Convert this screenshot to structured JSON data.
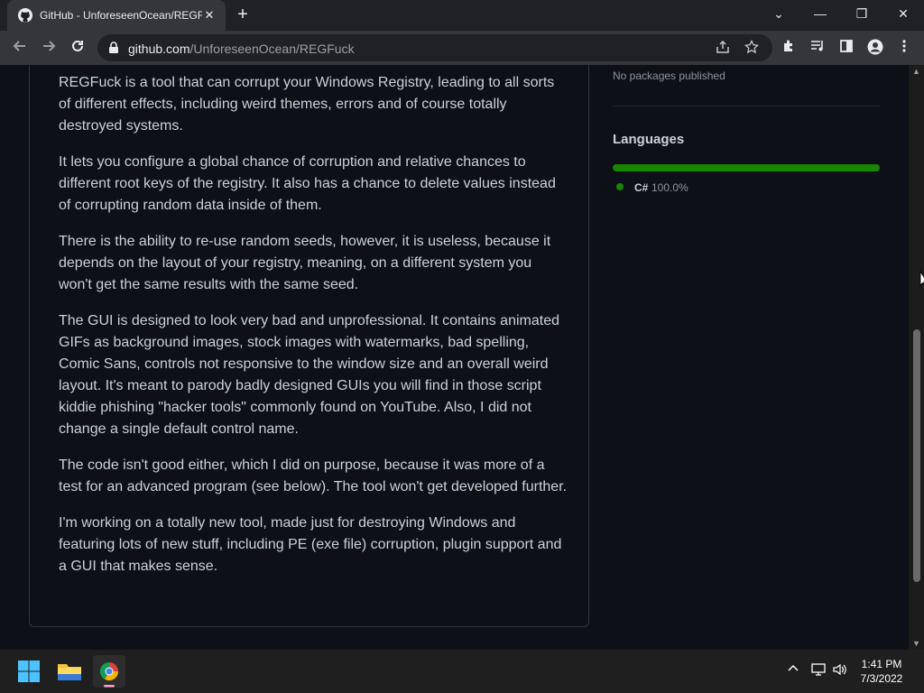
{
  "browser": {
    "tab_title": "GitHub - UnforeseenOcean/REGFuck",
    "tab_close": "✕",
    "new_tab": "+",
    "window_minimize": "—",
    "window_restore": "❐",
    "window_close": "✕",
    "tab_search": "⌄",
    "url_host": "github.com",
    "url_path": "/UnforeseenOcean/REGFuck"
  },
  "readme": {
    "paragraphs": [
      "REGFuck is a tool that can corrupt your Windows Registry, leading to all sorts of different effects, including weird themes, errors and of course totally destroyed systems.",
      "It lets you configure a global chance of corruption and relative chances to different root keys of the registry. It also has a chance to delete values instead of corrupting random data inside of them.",
      "There is the ability to re-use random seeds, however, it is useless, because it depends on the layout of your registry, meaning, on a different system you won't get the same results with the same seed.",
      "The GUI is designed to look very bad and unprofessional. It contains animated GIFs as background images, stock images with watermarks, bad spelling, Comic Sans, controls not responsive to the window size and an overall weird layout. It's meant to parody badly designed GUIs you will find in those script kiddie phishing \"hacker tools\" commonly found on YouTube. Also, I did not change a single default control name.",
      "The code isn't good either, which I did on purpose, because it was more of a test for an advanced program (see below). The tool won't get developed further.",
      "I'm working on a totally new tool, made just for destroying Windows and featuring lots of new stuff, including PE (exe file) corruption, plugin support and a GUI that makes sense."
    ]
  },
  "sidebar": {
    "packages_text": "No packages published",
    "languages_heading": "Languages",
    "languages": [
      {
        "name": "C#",
        "percent": "100.0%",
        "fraction": 1.0,
        "color": "#178600"
      }
    ]
  },
  "taskbar": {
    "time": "1:41 PM",
    "date": "7/3/2022"
  },
  "colors": {
    "page_bg": "#0d1117",
    "text": "#c9d1d9",
    "muted": "#8b949e",
    "border": "#30363d",
    "lang_csharp": "#178600"
  }
}
